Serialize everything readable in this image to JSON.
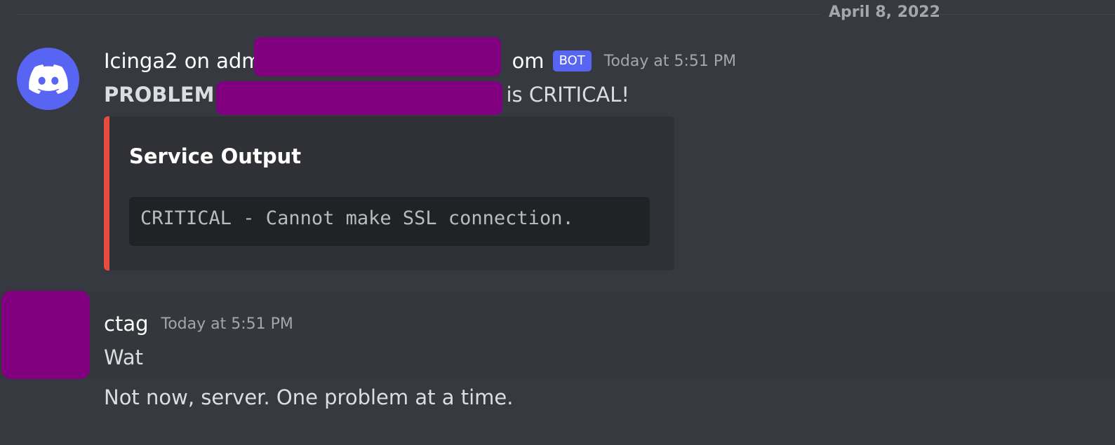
{
  "divider": {
    "date": "April 8, 2022"
  },
  "messages": [
    {
      "author": "Icinga2 on adm",
      "author_suffix": "om",
      "bot_tag": "BOT",
      "timestamp": "Today at 5:51 PM",
      "content_bold": "PROBLEM",
      "content_rest": "is CRITICAL!",
      "embed": {
        "title": "Service Output",
        "code": "CRITICAL - Cannot make SSL connection.",
        "accent_color": "#e74c3c"
      },
      "avatar_icon": "discord-logo-icon"
    },
    {
      "author": "ctag",
      "timestamp": "Today at 5:51 PM",
      "lines": [
        "Wat",
        "Not now, server. One problem at a time."
      ]
    }
  ],
  "colors": {
    "background": "#36393f",
    "bot_avatar": "#5865f2",
    "redaction": "#800080"
  }
}
